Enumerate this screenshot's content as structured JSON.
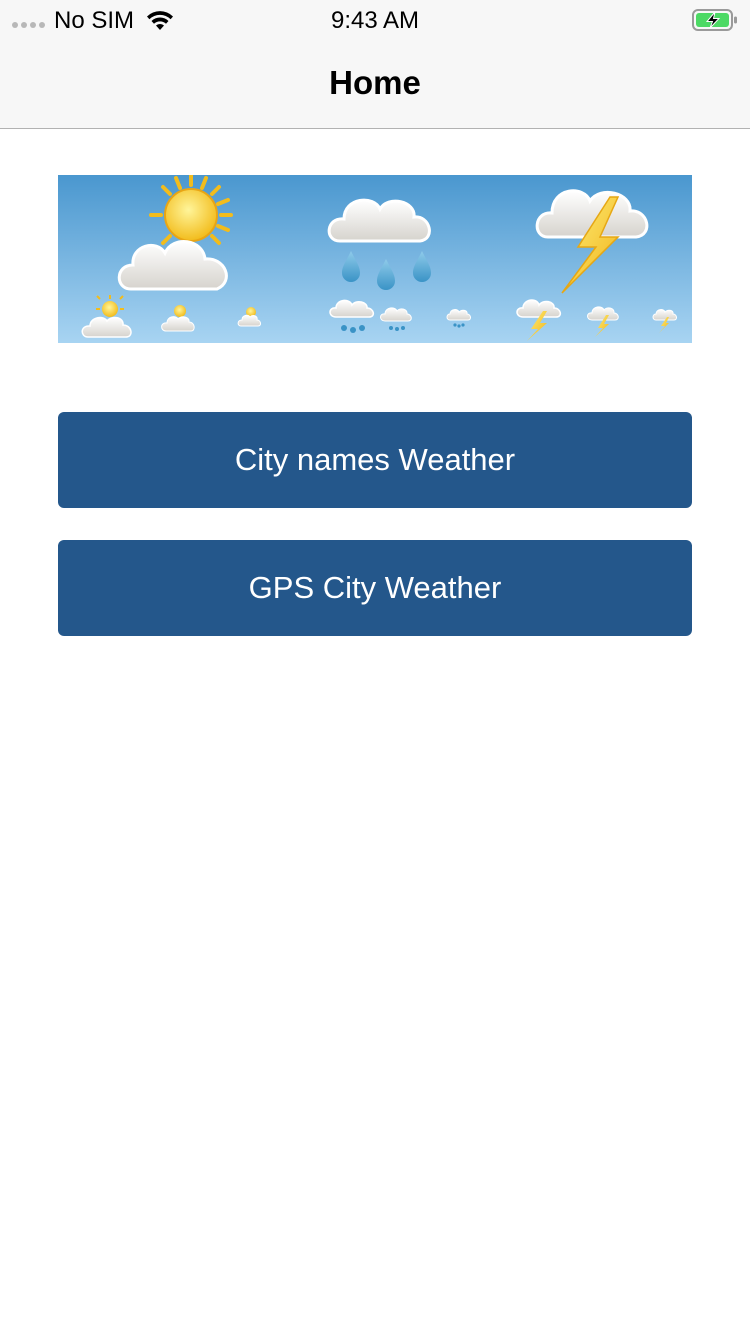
{
  "status_bar": {
    "carrier": "No SIM",
    "time": "9:43 AM",
    "battery_color": "#4cd964"
  },
  "nav": {
    "title": "Home"
  },
  "banner": {
    "icons": [
      "sun-cloud-icon",
      "rain-cloud-icon",
      "thunder-cloud-icon"
    ],
    "sky_colors": [
      "#4a97cf",
      "#a8d4f2"
    ]
  },
  "buttons": {
    "city_names": "City names Weather",
    "gps_city": "GPS City Weather"
  },
  "colors": {
    "button": "#24578b"
  }
}
